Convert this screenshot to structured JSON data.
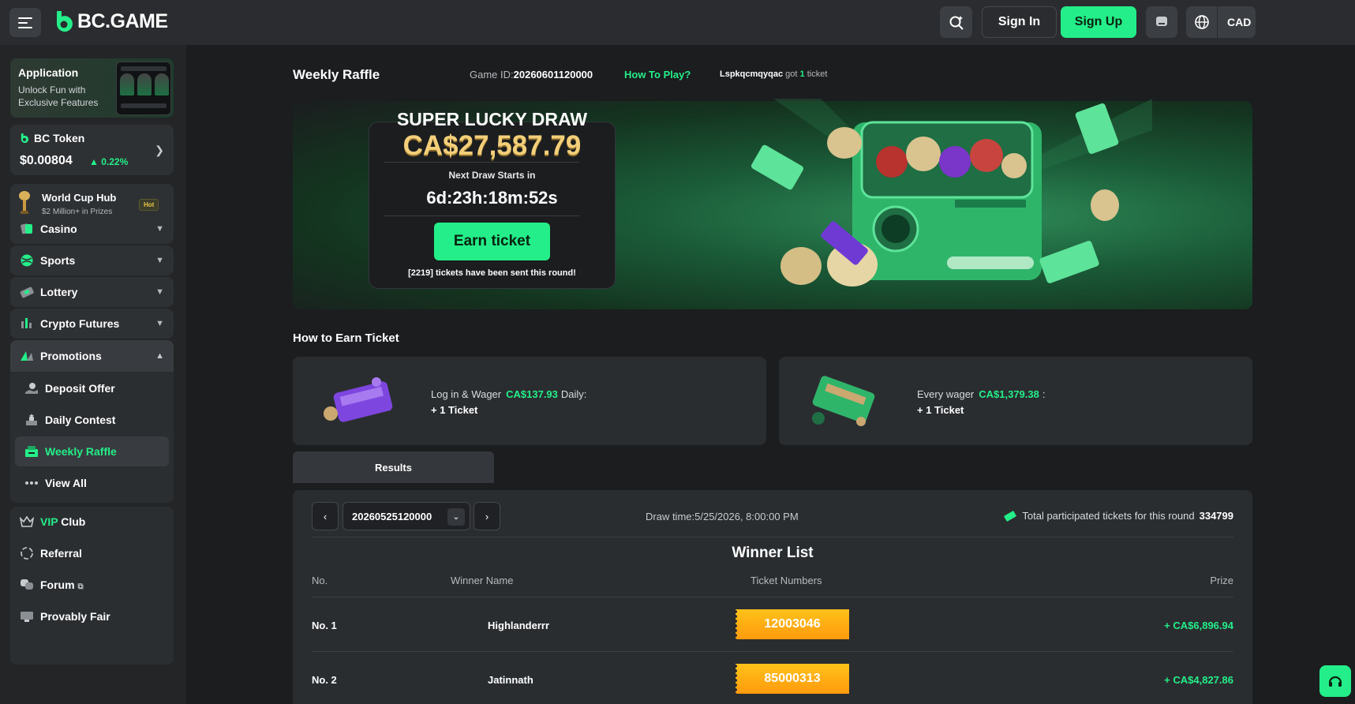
{
  "header": {
    "logo_text": "BC.GAME",
    "signin_label": "Sign In",
    "signup_label": "Sign Up",
    "currency": "CAD",
    "icons": [
      "menu-icon",
      "search-icon",
      "chat-icon",
      "globe-icon"
    ]
  },
  "sidebar": {
    "app": {
      "title": "Application",
      "subtitle": "Unlock Fun with Exclusive Features"
    },
    "token": {
      "name": "BC Token",
      "price": "$0.00804",
      "change": "0.22%"
    },
    "worldcup": {
      "title": "World Cup Hub",
      "subtitle": "$2 Million+ in Prizes",
      "badge": "Hot"
    },
    "nav": [
      {
        "label": "Casino",
        "icon": "casino-icon"
      },
      {
        "label": "Sports",
        "icon": "sports-icon"
      },
      {
        "label": "Lottery",
        "icon": "lottery-icon"
      },
      {
        "label": "Crypto Futures",
        "icon": "futures-icon"
      }
    ],
    "promotions": {
      "label": "Promotions",
      "items": [
        {
          "label": "Deposit Offer",
          "icon": "deposit-icon"
        },
        {
          "label": "Daily Contest",
          "icon": "contest-icon"
        },
        {
          "label": "Weekly Raffle",
          "icon": "raffle-icon",
          "active": true
        },
        {
          "label": "View All",
          "icon": "more-icon"
        }
      ]
    },
    "bottom": [
      {
        "label_vip": "VIP",
        "label": "Club",
        "icon": "crown-icon"
      },
      {
        "label": "Referral",
        "icon": "referral-icon"
      },
      {
        "label": "Forum",
        "icon": "forum-icon"
      },
      {
        "label": "Provably Fair",
        "icon": "fair-icon"
      }
    ]
  },
  "main": {
    "title": "Weekly Raffle",
    "game_id_label": "Game ID:",
    "game_id": "20260601120000",
    "how_to_play": "How To Play?",
    "got_user": "Lspkqcmqyqac",
    "got_text": "got",
    "got_count": "1",
    "got_suffix": "ticket",
    "draw": {
      "title": "SUPER LUCKY DRAW",
      "amount": "CA$27,587.79",
      "next_label": "Next Draw Starts in",
      "countdown": "6d:23h:18m:52s",
      "earn_button": "Earn ticket",
      "sent_text": "[2219] tickets have been sent this round!"
    },
    "earn_section_title": "How to Earn Ticket",
    "earn_cards": [
      {
        "prefix": "Log in & Wager",
        "amount": "CA$137.93",
        "suffix": "Daily:",
        "reward": "+ 1 Ticket"
      },
      {
        "prefix": "Every wager",
        "amount": "CA$1,379.38",
        "suffix": ":",
        "reward": "+ 1 Ticket"
      }
    ],
    "results_tab": "Results",
    "results": {
      "round_id": "20260525120000",
      "draw_time": "Draw time:5/25/2026, 8:00:00 PM",
      "total_label": "Total participated tickets for this round",
      "total_count": "334799",
      "winner_title": "Winner List",
      "columns": [
        "No.",
        "Winner Name",
        "Ticket Numbers",
        "Prize"
      ],
      "rows": [
        {
          "no": "No. 1",
          "name": "Highlanderrr",
          "ticket": "12003046",
          "prize": "+ CA$6,896.94"
        },
        {
          "no": "No. 2",
          "name": "Jatinnath",
          "ticket": "85000313",
          "prize": "+ CA$4,827.86"
        }
      ]
    }
  },
  "colors": {
    "accent": "#24ee89",
    "background": "#1b1d1f",
    "gold": "#f3cf7a",
    "ticket": "#ffa812"
  }
}
